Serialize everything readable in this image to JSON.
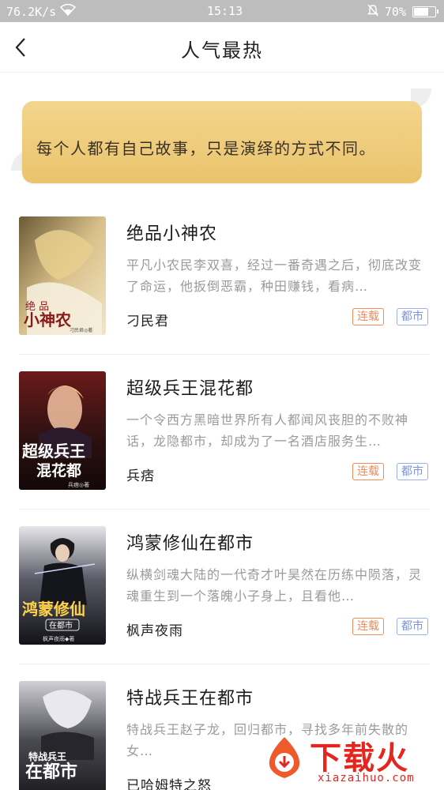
{
  "status_bar": {
    "network_speed": "76.2K/s",
    "time": "15:13",
    "battery_percent": "70%",
    "battery_level": 0.7
  },
  "header": {
    "title": "人气最热"
  },
  "banner": {
    "text": "每个人都有自己故事，只是演绎的方式不同。",
    "color": "#efcd7d"
  },
  "books": [
    {
      "title": "绝品小神农",
      "description": "平凡小农民李双喜，经过一番奇遇之后，彻底改变了命运，他扳倒恶霸，种田赚钱，看病…",
      "author": "刁民君",
      "status": "连载",
      "category": "都市",
      "cover_text": "绝品小神农",
      "cover_author": "刁民君◎著"
    },
    {
      "title": "超级兵王混花都",
      "description": "一个令西方黑暗世界所有人都闻风丧胆的不败神话，龙隐都市，却成为了一名酒店服务生…",
      "author": "兵痞",
      "status": "连载",
      "category": "都市",
      "cover_text": "超级兵王混花都",
      "cover_author": "兵痞◎著"
    },
    {
      "title": "鸿蒙修仙在都市",
      "description": "纵横剑魂大陆的一代奇才叶昊然在历练中陨落，灵魂重生到一个落魄小子身上，且看他…",
      "author": "枫声夜雨",
      "status": "连载",
      "category": "都市",
      "cover_text": "鸿蒙修仙",
      "cover_subtext": "在都市",
      "cover_author": "枫声夜雨◆著"
    },
    {
      "title": "特战兵王在都市",
      "description": "特战兵王赵子龙，回归都市，寻找多年前失散的女…",
      "author": "已哈姆特之怒",
      "status": "连载",
      "category": "都市",
      "cover_text": "特战兵王在都市"
    }
  ],
  "watermark": {
    "brand": "下载火",
    "domain": "xiazaihuo.com"
  }
}
